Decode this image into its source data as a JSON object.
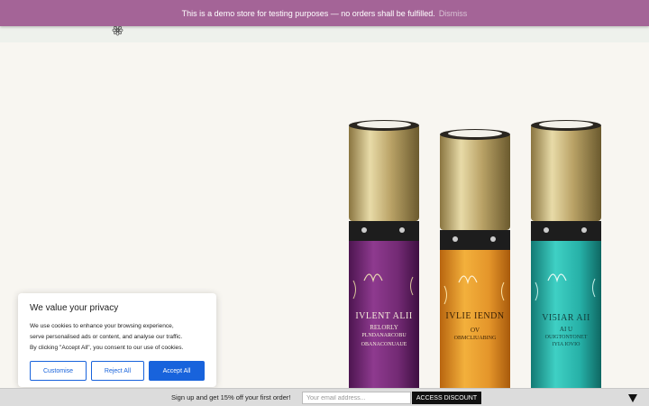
{
  "demo_notice": {
    "text": "This is a demo store for testing purposes — no orders shall be fulfilled.",
    "dismiss_label": "Dismiss"
  },
  "header": {
    "logo_icon": "flower-logo-icon"
  },
  "hero": {
    "bottles": [
      {
        "label_line1": "IVLENT ALII",
        "label_line2": "RELORLY",
        "label_line3": "PLNDANARCOBU",
        "label_line4": "OBANACONUAUE",
        "liquid_color": "#7a2c7e"
      },
      {
        "label_line1": "IVLIE IENDN",
        "label_line2": "OV",
        "label_line3": "OBMCLIUABING",
        "label_line4": "",
        "liquid_color": "#e79b2a"
      },
      {
        "label_line1": "VI5IAR AII",
        "label_line2": "AI U",
        "label_line3": "OUIGTONTONET",
        "label_line4": "IYIA IOVIO",
        "liquid_color": "#2bb8ae"
      }
    ]
  },
  "cookie_consent": {
    "title": "We value your privacy",
    "line1": "We use cookies to enhance your browsing experience,",
    "line2": "serve personalised ads or content, and analyse our traffic.",
    "line3": "By clicking \"Accept All\", you consent to our use of cookies.",
    "customise_label": "Customise",
    "reject_label": "Reject All",
    "accept_label": "Accept All"
  },
  "signup_bar": {
    "text": "Sign up and get 15% off your first order!",
    "email_placeholder": "Your email address...",
    "button_label": "ACCESS DISCOUNT",
    "toggle_icon": "triangle-down-icon"
  }
}
